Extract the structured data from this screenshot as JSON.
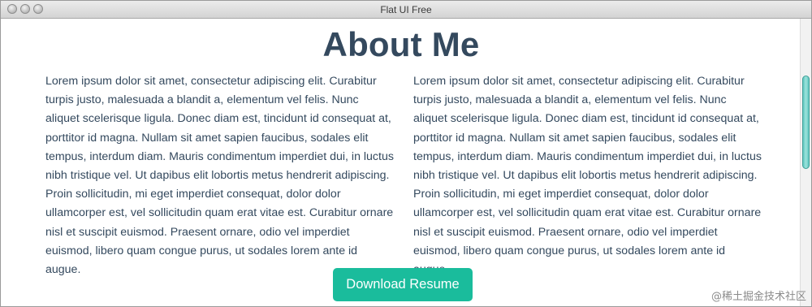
{
  "window": {
    "title": "Flat UI Free"
  },
  "main": {
    "heading": "About Me",
    "paragraph_left": "Lorem ipsum dolor sit amet, consectetur adipiscing elit. Curabitur turpis justo, malesuada a blandit a, elementum vel felis. Nunc aliquet scelerisque ligula. Donec diam est, tincidunt id consequat at, porttitor id magna. Nullam sit amet sapien faucibus, sodales elit tempus, interdum diam. Mauris condimentum imperdiet dui, in luctus nibh tristique vel. Ut dapibus elit lobortis metus hendrerit adipiscing. Proin sollicitudin, mi eget imperdiet consequat, dolor dolor ullamcorper est, vel sollicitudin quam erat vitae est. Curabitur ornare nisl et suscipit euismod. Praesent ornare, odio vel imperdiet euismod, libero quam congue purus, ut sodales lorem ante id augue.",
    "paragraph_right": "Lorem ipsum dolor sit amet, consectetur adipiscing elit. Curabitur turpis justo, malesuada a blandit a, elementum vel felis. Nunc aliquet scelerisque ligula. Donec diam est, tincidunt id consequat at, porttitor id magna. Nullam sit amet sapien faucibus, sodales elit tempus, interdum diam. Mauris condimentum imperdiet dui, in luctus nibh tristique vel. Ut dapibus elit lobortis metus hendrerit adipiscing. Proin sollicitudin, mi eget imperdiet consequat, dolor dolor ullamcorper est, vel sollicitudin quam erat vitae est. Curabitur ornare nisl et suscipit euismod. Praesent ornare, odio vel imperdiet euismod, libero quam congue purus, ut sodales lorem ante id augue.",
    "download_button_label": "Download Resume"
  },
  "watermark": "@稀土掘金技术社区",
  "colors": {
    "heading": "#34495e",
    "body_text": "#34495e",
    "button_bg": "#1abc9c",
    "button_text": "#ffffff"
  },
  "icons": {
    "close": "close-icon",
    "minimize": "minimize-icon",
    "zoom": "zoom-icon"
  }
}
